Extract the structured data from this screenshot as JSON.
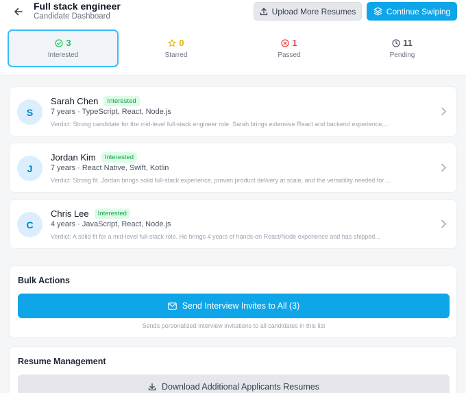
{
  "header": {
    "title": "Full stack engineer",
    "subtitle": "Candidate Dashboard",
    "upload_label": "Upload More Resumes",
    "continue_label": "Continue Swiping"
  },
  "stats": [
    {
      "count": "3",
      "label": "Interested",
      "color": "#22c55e",
      "icon": "check-circle-icon"
    },
    {
      "count": "0",
      "label": "Starred",
      "color": "#eab308",
      "icon": "star-icon"
    },
    {
      "count": "1",
      "label": "Passed",
      "color": "#ef4444",
      "icon": "x-circle-icon"
    },
    {
      "count": "11",
      "label": "Pending",
      "color": "#4b5563",
      "icon": "clock-icon"
    }
  ],
  "candidates": [
    {
      "initial": "S",
      "name": "Sarah Chen",
      "status": "Interested",
      "meta": "7 years · TypeScript, React, Node.js",
      "verdict": "Verdict: Strong candidate for the mid-level full-stack engineer role. Sarah brings extensive React and backend experience,..."
    },
    {
      "initial": "J",
      "name": "Jordan Kim",
      "status": "Interested",
      "meta": "7 years · React Native, Swift, Kotlin",
      "verdict": "Verdict: Strong fit. Jordan brings solid full-stack experience, proven product delivery at scale, and the versatility needed for ..."
    },
    {
      "initial": "C",
      "name": "Chris Lee",
      "status": "Interested",
      "meta": "4 years · JavaScript, React, Node.js",
      "verdict": "Verdict: A solid fit for a mid-level full-stack role. He brings 4 years of hands-on React/Node experience and has shipped..."
    }
  ],
  "bulk": {
    "title": "Bulk Actions",
    "invite_label": "Send Interview Invites to All (3)",
    "note": "Sends personalized interview invitations to all candidates in this list"
  },
  "resume": {
    "title": "Resume Management",
    "download_label": "Download Additional Applicants Resumes"
  }
}
